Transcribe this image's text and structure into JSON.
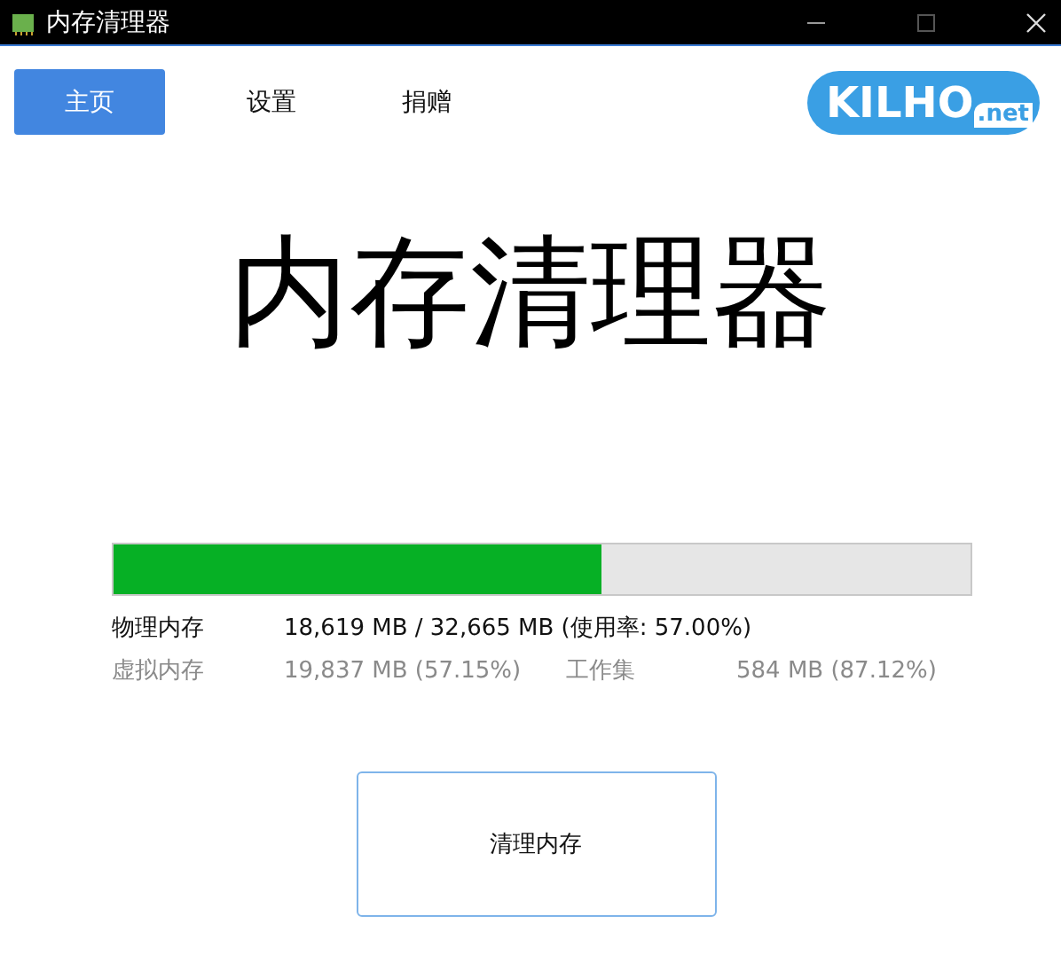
{
  "window": {
    "title": "内存清理器"
  },
  "tabs": [
    {
      "label": "主页",
      "selected": true
    },
    {
      "label": "设置",
      "selected": false
    },
    {
      "label": "捐赠",
      "selected": false
    }
  ],
  "logo": {
    "name": "KILHO",
    "suffix": ".net"
  },
  "heading": "内存清理器",
  "memory": {
    "level": 0.57
  },
  "stats": [
    {
      "kind": "primary",
      "cells": [
        "物理内存",
        "18,619 MB / 32,665 MB (使用率: 57.00%)"
      ]
    },
    {
      "kind": "secondary",
      "cells": [
        "虚拟内存",
        "19,837 MB (57.15%)",
        "工作集",
        "584 MB (87.12%)"
      ]
    }
  ],
  "action": "清理内存"
}
